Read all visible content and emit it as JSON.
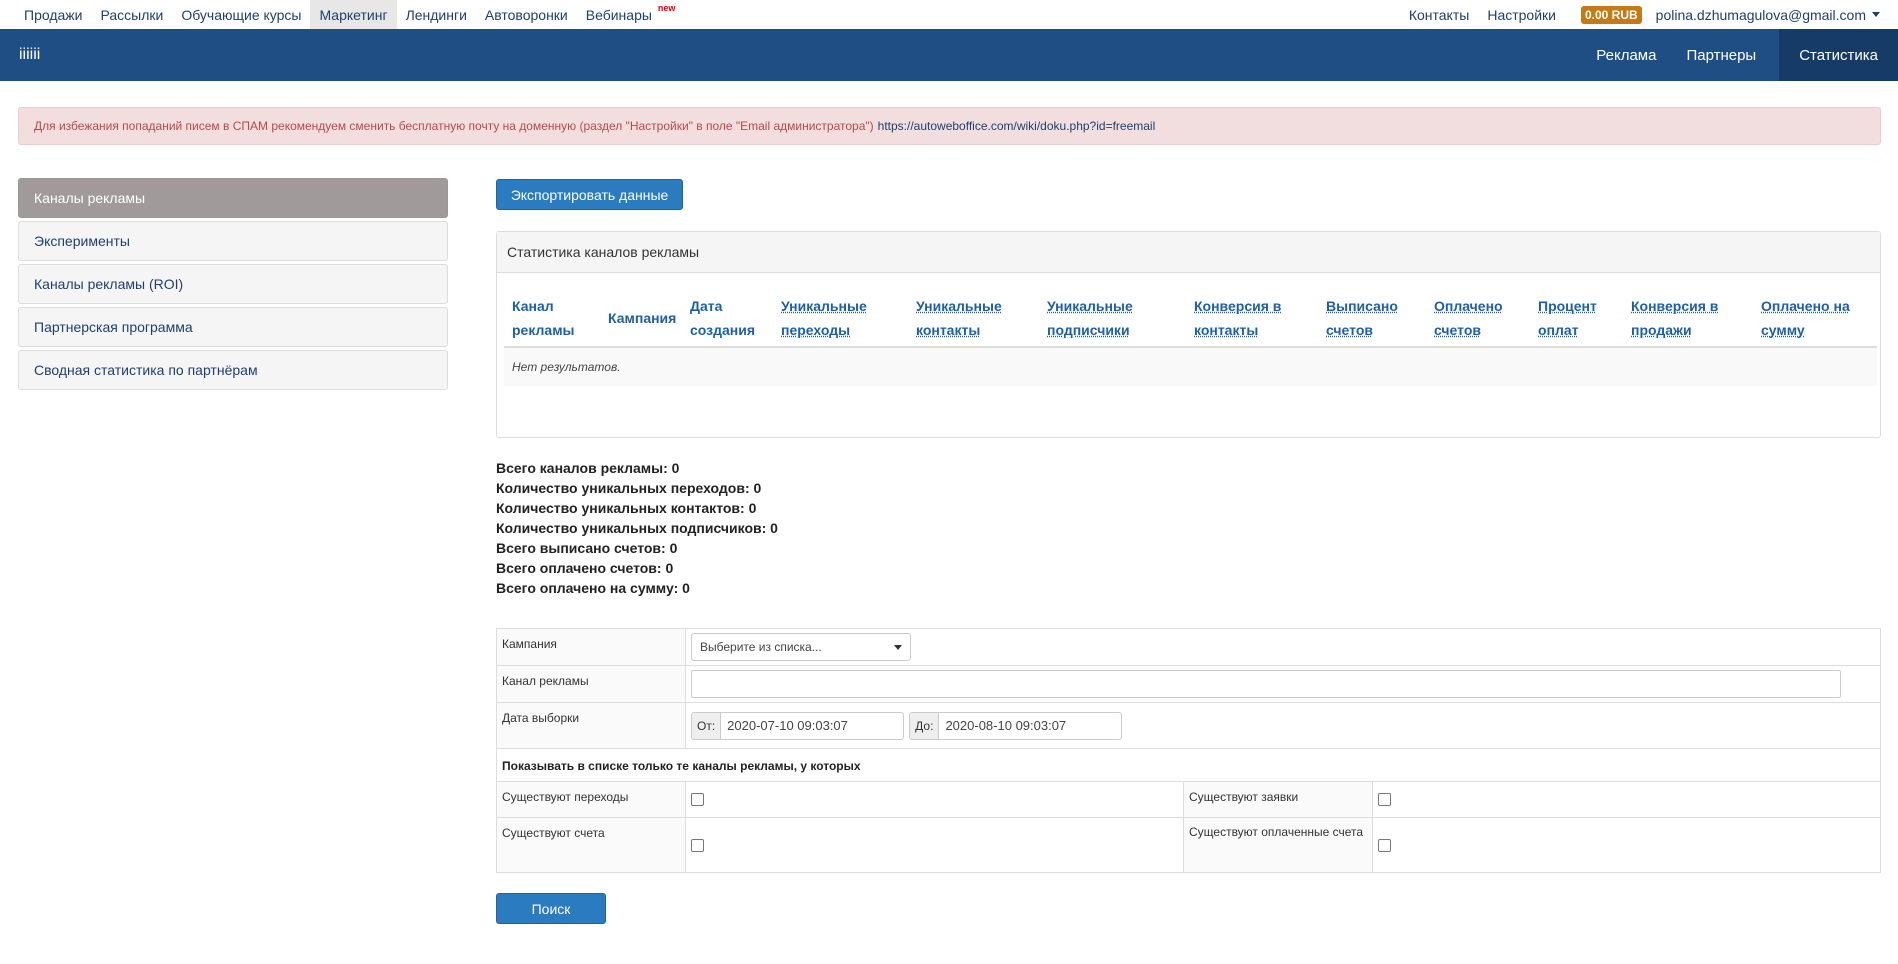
{
  "topnav": {
    "items": [
      "Продажи",
      "Рассылки",
      "Обучающие курсы",
      "Маркетинг",
      "Лендинги",
      "Автоворонки",
      "Вебинары"
    ],
    "new_badge": "new",
    "contacts": "Контакты",
    "settings": "Настройки",
    "balance": "0.00 RUB",
    "user_email": "polina.dzhumagulova@gmail.com"
  },
  "bluebar": {
    "brand": "iiiiii",
    "items": [
      "Реклама",
      "Партнеры",
      "Статистика"
    ]
  },
  "alert": {
    "text": "Для избежания попаданий писем в СПАМ рекомендуем сменить бесплатную почту на доменную (раздел \"Настройки\" в поле \"Email администратора\")",
    "link": "https://autoweboffice.com/wiki/doku.php?id=freemail"
  },
  "sidebar": {
    "items": [
      "Каналы рекламы",
      "Эксперименты",
      "Каналы рекламы (ROI)",
      "Партнерская программа",
      "Сводная статистика по партнёрам"
    ]
  },
  "export_button": "Экспортировать данные",
  "panel": {
    "title": "Статистика каналов рекламы",
    "columns": [
      [
        "Канал",
        "рекламы"
      ],
      [
        "Кампания",
        ""
      ],
      [
        "Дата",
        "создания"
      ],
      [
        "Уникальные",
        "переходы"
      ],
      [
        "Уникальные",
        "контакты"
      ],
      [
        "Уникальные",
        "подписчики"
      ],
      [
        "Конверсия в",
        "контакты"
      ],
      [
        "Выписано",
        "счетов"
      ],
      [
        "Оплачено",
        "счетов"
      ],
      [
        "Процент",
        "оплат"
      ],
      [
        "Конверсия в",
        "продажи"
      ],
      [
        "Оплачено на",
        "сумму"
      ]
    ],
    "empty": "Нет результатов."
  },
  "summary": [
    "Всего каналов рекламы: 0",
    "Количество уникальных переходов: 0",
    "Количество уникальных контактов: 0",
    "Количество уникальных подписчиков: 0",
    "Всего выписано счетов: 0",
    "Всего оплачено счетов: 0",
    "Всего оплачено на сумму: 0"
  ],
  "filter": {
    "campaign_label": "Кампания",
    "campaign_placeholder": "Выберите из списка...",
    "channel_label": "Канал рекламы",
    "date_label": "Дата выборки",
    "from_label": "От:",
    "from_value": "2020-07-10 09:03:07",
    "to_label": "До:",
    "to_value": "2020-08-10 09:03:07",
    "show_only": "Показывать в списке только те каналы рекламы, у которых",
    "has_clicks": "Существуют переходы",
    "has_requests": "Существуют заявки",
    "has_invoices": "Существуют счета",
    "has_paid_invoices": "Существуют оплаченные счета"
  },
  "search_button": "Поиск"
}
